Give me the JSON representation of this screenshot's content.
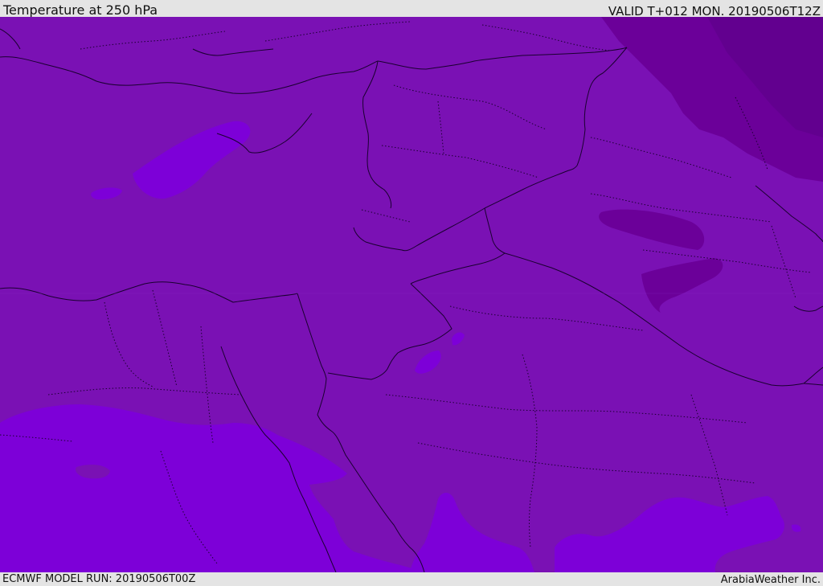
{
  "header": {
    "title": "Temperature at 250 hPa",
    "valid_time": "VALID T+012 MON. 20190506T12Z"
  },
  "footer": {
    "model_run": "ECMWF MODEL RUN: 20190506T00Z",
    "credit": "ArabiaWeather Inc."
  },
  "map": {
    "colors": {
      "base": "#7a11b4",
      "warmer": "#7d00d8",
      "cold": "#6b0099",
      "cold_dark": "#62008f",
      "border": "#1a0030"
    }
  }
}
